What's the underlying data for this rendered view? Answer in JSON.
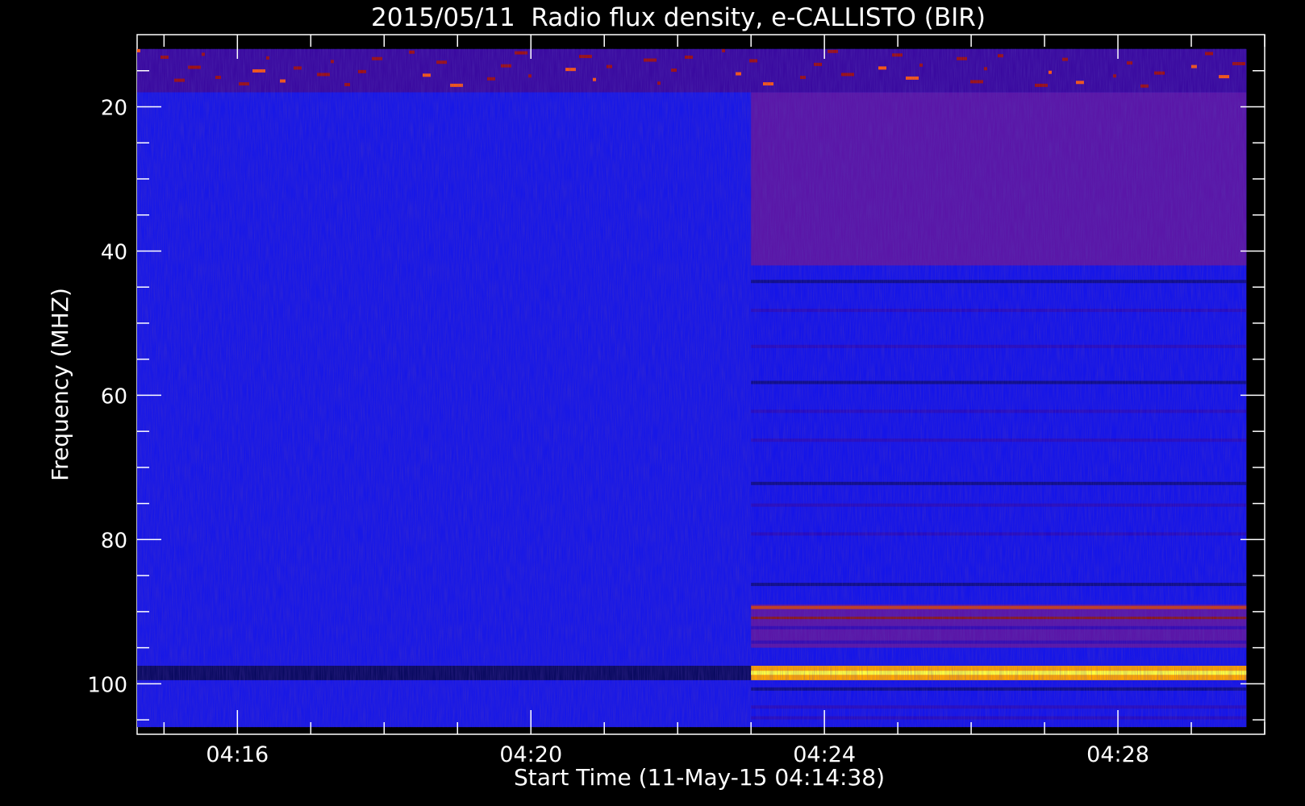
{
  "chart_data": {
    "type": "heatmap",
    "title": "2015/05/11  Radio flux density, e-CALLISTO (BIR)",
    "xlabel": "Start Time (11-May-15 04:14:38)",
    "ylabel": "Frequency (MHZ)",
    "x_ticks": [
      "04:16",
      "04:20",
      "04:24",
      "04:28"
    ],
    "y_ticks": [
      "20",
      "40",
      "60",
      "80",
      "100"
    ],
    "xlim": [
      "04:14:38",
      "04:30:00"
    ],
    "ylim": [
      10,
      107
    ],
    "y_inverted": true,
    "data_time_range": [
      "04:14:38",
      "04:29:45"
    ],
    "data_freq_range": [
      12,
      106
    ],
    "segment_change_time": "04:23:00",
    "colormap": [
      "#000000",
      "#0000ff",
      "#8b0000",
      "#ff4500",
      "#ffff00"
    ],
    "features": [
      {
        "time": [
          "04:14:38",
          "04:29:45"
        ],
        "freq": [
          12,
          18
        ],
        "level": "high-noise"
      },
      {
        "time": [
          "04:14:38",
          "04:23:00"
        ],
        "freq": [
          18,
          106
        ],
        "level": "background"
      },
      {
        "time": [
          "04:23:00",
          "04:29:45"
        ],
        "freq": [
          18,
          42
        ],
        "level": "elevated"
      },
      {
        "time": [
          "04:23:00",
          "04:29:45"
        ],
        "freq": [
          89,
          95
        ],
        "level": "elevated"
      },
      {
        "time": [
          "04:23:00",
          "04:29:45"
        ],
        "freq": [
          97.5,
          99.5
        ],
        "level": "peak"
      },
      {
        "time": [
          "04:14:38",
          "04:23:00"
        ],
        "freq": [
          97.5,
          99.5
        ],
        "level": "low"
      }
    ]
  }
}
